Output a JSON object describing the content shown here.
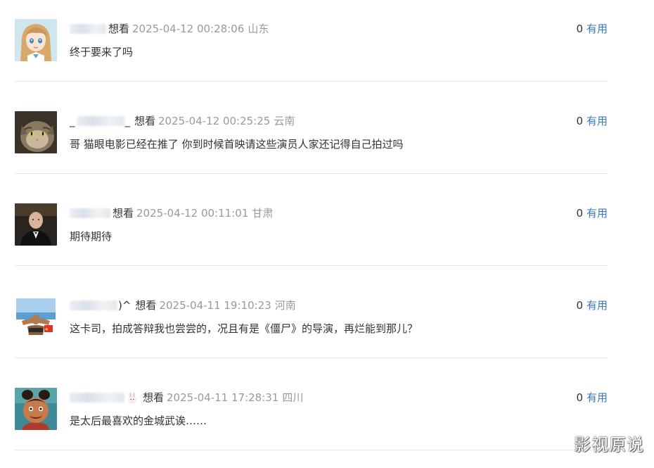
{
  "comments": [
    {
      "name_suffix": "",
      "status": "想看",
      "time": "2025-04-12 00:28:06",
      "region": "山东",
      "content": "终于要来了吗",
      "useful_count": "0",
      "useful_label": "有用"
    },
    {
      "name_suffix": "_",
      "status": "想看",
      "time": "2025-04-12 00:25:25",
      "region": "云南",
      "content": "哥 猫眼电影已经在推了 你到时候首映请这些演员人家还记得自己拍过吗",
      "useful_count": "0",
      "useful_label": "有用"
    },
    {
      "name_suffix": "",
      "status": "想看",
      "time": "2025-04-12 00:11:01",
      "region": "甘肃",
      "content": "期待期待",
      "useful_count": "0",
      "useful_label": "有用"
    },
    {
      "name_suffix": ")^",
      "status": "想看",
      "time": "2025-04-11 19:10:23",
      "region": "河南",
      "content": "这卡司，拍成答辩我也尝尝的，况且有是《僵尸》的导演，再烂能到那儿？",
      "useful_count": "0",
      "useful_label": "有用"
    },
    {
      "name_suffix": "",
      "status": "想看",
      "time": "2025-04-11 17:28:31",
      "region": "四川",
      "content": "是太后最喜欢的金城武诶……",
      "useful_count": "0",
      "useful_label": "有用"
    }
  ],
  "watermark": "影视原说",
  "colors": {
    "link": "#3b78b8",
    "meta": "#999999",
    "text": "#333333",
    "divider": "#e8e8e8"
  }
}
